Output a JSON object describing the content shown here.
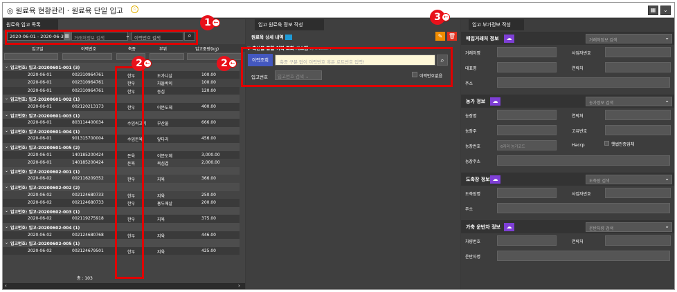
{
  "title": "원료육 현황관리 · 원료육 단일 입고",
  "left": {
    "header": "원료육 입고 목록",
    "date_range": "2020-06-01 - 2020-06-30",
    "partner_placeholder": "거래처정보 검색",
    "trace_placeholder": "이력번호 검색",
    "columns": [
      "입고일",
      "이력번호",
      "축종",
      "부위",
      "입고중량(kg)"
    ],
    "rows": [
      {
        "g": "입고번호: 입고-20200601-001 (3)"
      },
      {
        "d": "2020-06-01",
        "n": "002310964761",
        "s": "한우",
        "p": "도가니살",
        "w": "100.00"
      },
      {
        "d": "2020-06-01",
        "n": "002310964761",
        "s": "한우",
        "p": "차돌박이",
        "w": "100.00"
      },
      {
        "d": "2020-06-01",
        "n": "002310964761",
        "s": "한우",
        "p": "등심",
        "w": "120.00"
      },
      {
        "g": "입고번호: 입고-20200601-002 (1)"
      },
      {
        "d": "2020-06-01",
        "n": "002120213173",
        "s": "한우",
        "p": "이분도체",
        "w": "400.00"
      },
      {
        "g": "입고번호: 입고-20200601-003 (1)"
      },
      {
        "d": "2020-06-01",
        "n": "803114400034",
        "s": "수입쇠고기",
        "p": "부산물",
        "w": "666.00"
      },
      {
        "g": "입고번호: 입고-20200601-004 (1)"
      },
      {
        "d": "2020-06-01",
        "n": "901315700004",
        "s": "수입돈육",
        "p": "앞다리",
        "w": "456.00"
      },
      {
        "g": "입고번호: 입고-20200601-005 (2)"
      },
      {
        "d": "2020-06-01",
        "n": "140185200424",
        "s": "돈육",
        "p": "이분도체",
        "w": "3,000.00"
      },
      {
        "d": "2020-06-01",
        "n": "140185200424",
        "s": "돈육",
        "p": "목심겹",
        "w": "2,000.00"
      },
      {
        "g": "입고번호: 입고-20200602-001 (1)"
      },
      {
        "d": "2020-06-02",
        "n": "002116209352",
        "s": "한우",
        "p": "지육",
        "w": "366.00"
      },
      {
        "g": "입고번호: 입고-20200602-002 (2)"
      },
      {
        "d": "2020-06-02",
        "n": "002124680733",
        "s": "한우",
        "p": "지육",
        "w": "250.00"
      },
      {
        "d": "2020-06-02",
        "n": "002124680733",
        "s": "한우",
        "p": "홍두깨살",
        "w": "200.00"
      },
      {
        "g": "입고번호: 입고-20200602-003 (1)"
      },
      {
        "d": "2020-06-02",
        "n": "002119275918",
        "s": "한우",
        "p": "지육",
        "w": "375.00"
      },
      {
        "g": "입고번호: 입고-20200602-004 (1)"
      },
      {
        "d": "2020-06-02",
        "n": "002124680768",
        "s": "한우",
        "p": "지육",
        "w": "446.00"
      },
      {
        "g": "입고번호: 입고-20200602-005 (1)"
      },
      {
        "d": "2020-06-02",
        "n": "002124679501",
        "s": "한우",
        "p": "지육",
        "w": "425.00"
      }
    ],
    "total": "총 : 103"
  },
  "mid": {
    "header": "입고 원료육 정보 작성",
    "detail_title": "원료육 상세 내역",
    "system_title": "축산물 통합 이력 조회 시스템",
    "system_by": "by DNBSOFT",
    "trace_btn": "이력조회",
    "trace_placeholder": "축종 구분 없이 이력번호 혹은 로트번호 입력!",
    "in_no_label": "입고번호",
    "in_no_placeholder": "입고번호 검색",
    "no_trace_label": "이력번호없음"
  },
  "right": {
    "header": "입고 부가정보 작성",
    "sections": [
      {
        "title": "매입거래처 정보",
        "search": "거래처정보 검색",
        "fields": [
          [
            "거래처명",
            "사업자번호"
          ],
          [
            "대표명",
            "연락처"
          ],
          [
            "주소",
            ""
          ]
        ]
      },
      {
        "title": "농가 정보",
        "search": "농가정보 검색",
        "fields": [
          [
            "농장명",
            "연락처"
          ],
          [
            "농장주",
            "고유번호"
          ],
          [
            "농장번호",
            "Haccp"
          ],
          [
            "농장주소",
            ""
          ]
        ],
        "farm_no_placeholder": "6자리 농가코드",
        "eco_label": "햇썹인증업체"
      },
      {
        "title": "도축장 정보",
        "search": "도축장 검색",
        "fields": [
          [
            "도축장명",
            "사업자번호"
          ],
          [
            "주소",
            ""
          ]
        ]
      },
      {
        "title": "가축 운반차 정보",
        "search": "운반차량 검색",
        "fields": [
          [
            "차량번호",
            "연락처"
          ],
          [
            "운반자명",
            ""
          ]
        ]
      }
    ]
  },
  "badges": [
    "1",
    "2",
    "2",
    "3"
  ]
}
